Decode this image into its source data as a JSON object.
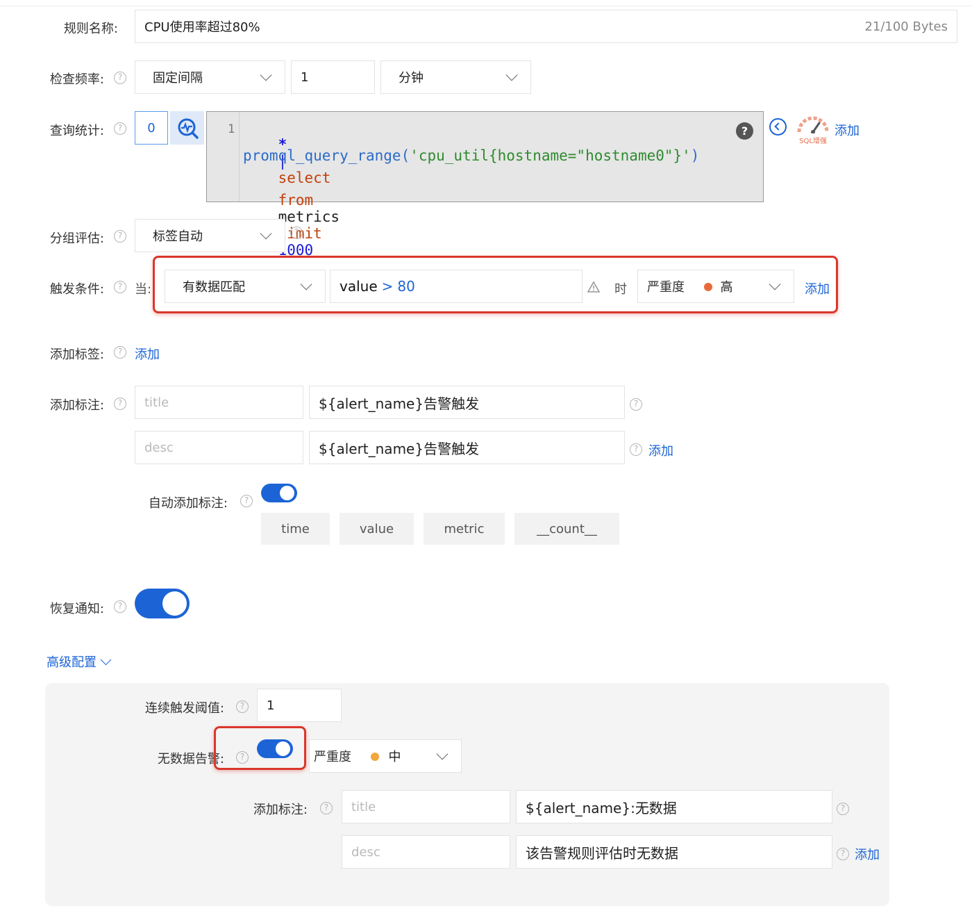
{
  "rule_name": {
    "label": "规则名称:",
    "value": "CPU使用率超过80%",
    "counter": "21/100 Bytes"
  },
  "check_frequency": {
    "label": "检查频率:",
    "mode": "固定间隔",
    "number": "1",
    "unit": "分钟"
  },
  "query": {
    "label": "查询统计:",
    "index": "0",
    "line_number": "1",
    "code": {
      "l1_star": "*",
      "l1_pipe": "|",
      "l1_select": "select",
      "l2_func": "promql_query_range(",
      "l2_str": "'cpu_util{hostname=\"hostname0\"}'",
      "l2_close": ")",
      "l3_from": "from",
      "l3_metrics": "metrics",
      "l3_limit": "limit",
      "l3_num": "1000"
    },
    "help_badge": "?",
    "sql_logo_text": "SQL增强",
    "add_label": "添加"
  },
  "group_eval": {
    "label": "分组评估:",
    "value": "标签自动"
  },
  "trigger": {
    "label": "触发条件:",
    "when": "当:",
    "match": "有数据匹配",
    "expr_var": "value",
    "expr_op": ">",
    "expr_num": "80",
    "time_word": "时",
    "severity_label": "严重度",
    "severity_value": "高",
    "severity_color": "#e86a3a",
    "add_label": "添加"
  },
  "add_tags": {
    "label": "添加标签:",
    "add_label": "添加"
  },
  "annotations": {
    "label": "添加标注:",
    "rows": [
      {
        "key_placeholder": "title",
        "value": "${alert_name}告警触发"
      },
      {
        "key_placeholder": "desc",
        "value": "${alert_name}告警触发"
      }
    ],
    "add_label": "添加"
  },
  "auto_annotations": {
    "label": "自动添加标注:",
    "enabled": true,
    "chips": [
      "time",
      "value",
      "metric",
      "__count__"
    ]
  },
  "recovery_notice": {
    "label": "恢复通知:",
    "enabled": true
  },
  "advanced": {
    "toggle_label": "高级配置",
    "consecutive": {
      "label": "连续触发阈值:",
      "value": "1"
    },
    "no_data": {
      "label": "无数据告警:",
      "enabled": true,
      "severity_label": "严重度",
      "severity_value": "中",
      "severity_color": "#f2a63b"
    },
    "annotations": {
      "label": "添加标注:",
      "rows": [
        {
          "key_placeholder": "title",
          "value": "${alert_name}:无数据"
        },
        {
          "key_placeholder": "desc",
          "value": "该告警规则评估时无数据"
        }
      ],
      "add_label": "添加"
    }
  },
  "colors": {
    "accent": "#1c64d6",
    "highlight": "#d9372b",
    "code_bg": "#e6e6e6"
  }
}
